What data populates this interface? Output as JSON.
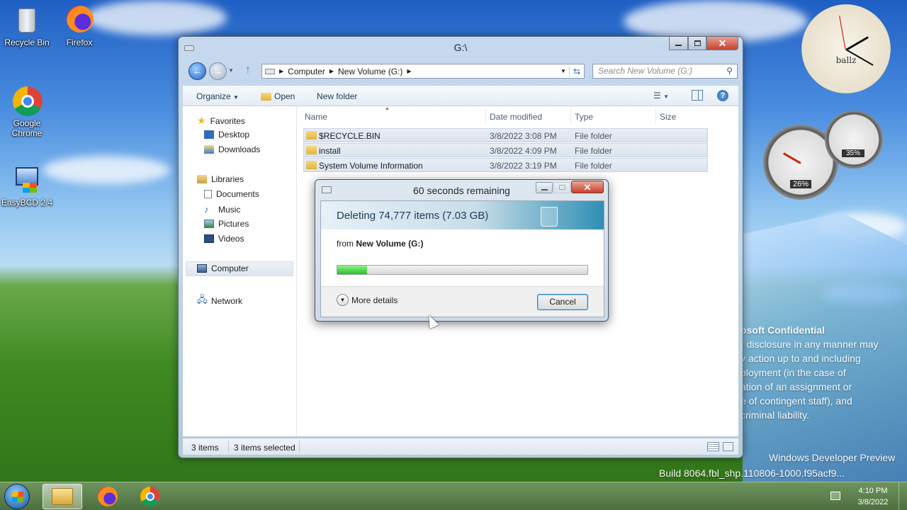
{
  "desktop": {
    "icons": [
      {
        "label": "Recycle Bin"
      },
      {
        "label": "Firefox"
      },
      {
        "label": "Google Chrome"
      },
      {
        "label": "EasyBCD 2.4"
      }
    ]
  },
  "explorer": {
    "title": "G:\\",
    "breadcrumb": [
      "Computer",
      "New Volume (G:)"
    ],
    "search_placeholder": "Search New Volume (G:)",
    "toolbar": {
      "organize": "Organize",
      "open": "Open",
      "new_folder": "New folder"
    },
    "nav": {
      "favorites": "Favorites",
      "favorites_items": [
        "Desktop",
        "Downloads"
      ],
      "libraries": "Libraries",
      "libraries_items": [
        "Documents",
        "Music",
        "Pictures",
        "Videos"
      ],
      "computer": "Computer",
      "network": "Network"
    },
    "columns": [
      "Name",
      "Date modified",
      "Type",
      "Size"
    ],
    "files": [
      {
        "name": "$RECYCLE.BIN",
        "date": "3/8/2022 3:08 PM",
        "type": "File folder"
      },
      {
        "name": "install",
        "date": "3/8/2022 4:09 PM",
        "type": "File folder"
      },
      {
        "name": "System Volume Information",
        "date": "3/8/2022 3:19 PM",
        "type": "File folder"
      }
    ],
    "status": {
      "count": "3 items",
      "selected": "3 items selected"
    }
  },
  "dialog": {
    "title": "60 seconds remaining",
    "heading": "Deleting 74,777 items (7.03 GB)",
    "from_label": "from",
    "from_value": "New Volume (G:)",
    "progress": 0.12,
    "more_details": "More details",
    "cancel": "Cancel"
  },
  "gadgets": {
    "clock_label": "ballz",
    "cpu": "26%",
    "memory": "35%"
  },
  "watermark": {
    "lines": [
      "osoft Confidential",
      "r disclosure in any manner may",
      "y action up to and including",
      "ployment (in the case of",
      "ation of an assignment or",
      "e of contingent staff), and",
      "criminal liability.",
      "Windows Developer Preview",
      "Build 8064.fbl_shp.110806-1000.f95acf9..."
    ]
  },
  "taskbar": {
    "time": "4:10 PM",
    "date": "3/8/2022"
  },
  "colors": {
    "accent": "#3a8dc5",
    "progress": "#2bc02a",
    "selection": "#dae3ef"
  }
}
